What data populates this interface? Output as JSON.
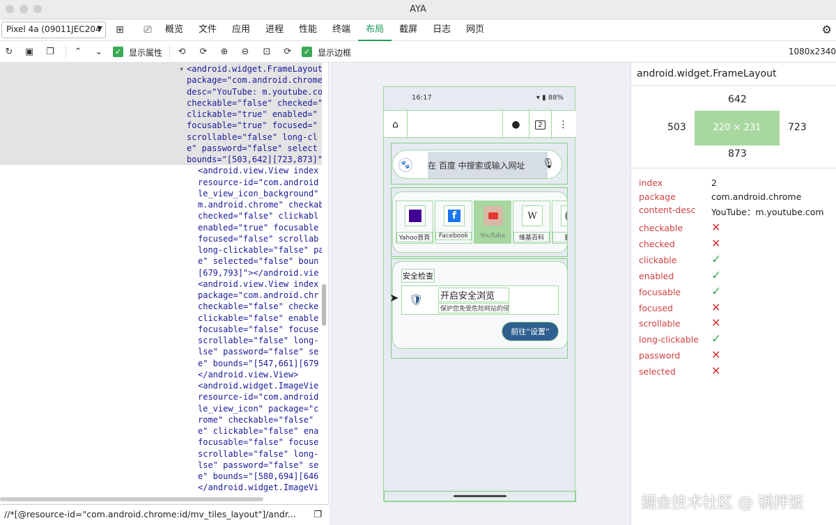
{
  "window": {
    "title": "AYA"
  },
  "menubar": {
    "device": "Pixel 4a (09011JEC204",
    "tabs": [
      "概览",
      "文件",
      "应用",
      "进程",
      "性能",
      "终端",
      "布局",
      "截屏",
      "日志",
      "网页"
    ],
    "active_tab": "布局"
  },
  "toolbar": {
    "show_attrs_label": "显示属性",
    "show_border_label": "显示边框",
    "resolution": "1080x2340"
  },
  "xml_lines": [
    "<android.widget.FrameLayout",
    "package=\"com.android.chrome",
    "desc=\"YouTube: m.youtube.co",
    "checkable=\"false\" checked=\"",
    "clickable=\"true\" enabled=\"",
    "focusable=\"true\" focused=\"",
    "scrollable=\"false\" long-cl",
    "e\" password=\"false\" select",
    "bounds=\"[503,642][723,873]\"",
    "  <android.view.View index",
    "  resource-id=\"com.android",
    "  le_view_icon_background\"",
    "  m.android.chrome\" checkab",
    "  checked=\"false\" clickabl",
    "  enabled=\"true\" focusable",
    "  focused=\"false\" scrollab",
    "  long-clickable=\"false\" pa",
    "  e\" selected=\"false\" boun",
    "  [679,793]\"></android.vie",
    "  <android.view.View index",
    "  package=\"com.android.chr",
    "  checkable=\"false\" checke",
    "  clickable=\"false\" enable",
    "  focusable=\"false\" focuse",
    "  scrollable=\"false\" long-",
    "  lse\" password=\"false\" se",
    "  e\" bounds=\"[547,661][679",
    "  </android.view.View>",
    "  <android.widget.ImageVie",
    "  resource-id=\"com.android",
    "  le_view_icon\" package=\"c",
    "  rome\" checkable=\"false\"",
    "  e\" clickable=\"false\" ena",
    "  focusable=\"false\" focuse",
    "  scrollable=\"false\" long-",
    "  lse\" password=\"false\" se",
    "  e\" bounds=\"[580,694][646",
    "  </android.widget.ImageVi"
  ],
  "xpath": "//*[@resource-id=\"com.android.chrome:id/mv_tiles_layout\"]/andr...",
  "phone": {
    "status_time": "16:17",
    "status_battery": "88%",
    "tab_count": "2",
    "search_placeholder": "在 百度 中搜索或输入网址",
    "tiles": [
      {
        "label": "Yahoo首頁"
      },
      {
        "label": "Facebook"
      },
      {
        "label": "YouTube"
      },
      {
        "label": "维基百科"
      },
      {
        "label": "要聞"
      }
    ],
    "security_title": "安全检查",
    "security_heading": "开启安全浏览",
    "security_sub": "保护您免受危险网站的侵害",
    "security_button": "前往“设置”"
  },
  "props": {
    "class_name": "android.widget.FrameLayout",
    "box": {
      "top": "642",
      "left": "503",
      "right": "723",
      "bottom": "873",
      "size": "220 × 231"
    },
    "rows": [
      {
        "key": "index",
        "value": "2"
      },
      {
        "key": "package",
        "value": "com.android.chrome"
      },
      {
        "key": "content-desc",
        "value": "YouTube：m.youtube.com"
      },
      {
        "key": "checkable",
        "value": "✕"
      },
      {
        "key": "checked",
        "value": "✕"
      },
      {
        "key": "clickable",
        "value": "✓"
      },
      {
        "key": "enabled",
        "value": "✓"
      },
      {
        "key": "focusable",
        "value": "✓"
      },
      {
        "key": "focused",
        "value": "✕"
      },
      {
        "key": "scrollable",
        "value": "✕"
      },
      {
        "key": "long-clickable",
        "value": "✓"
      },
      {
        "key": "password",
        "value": "✕"
      },
      {
        "key": "selected",
        "value": "✕"
      }
    ]
  },
  "watermark": "掘金技术社区 @ 锅拌饭"
}
